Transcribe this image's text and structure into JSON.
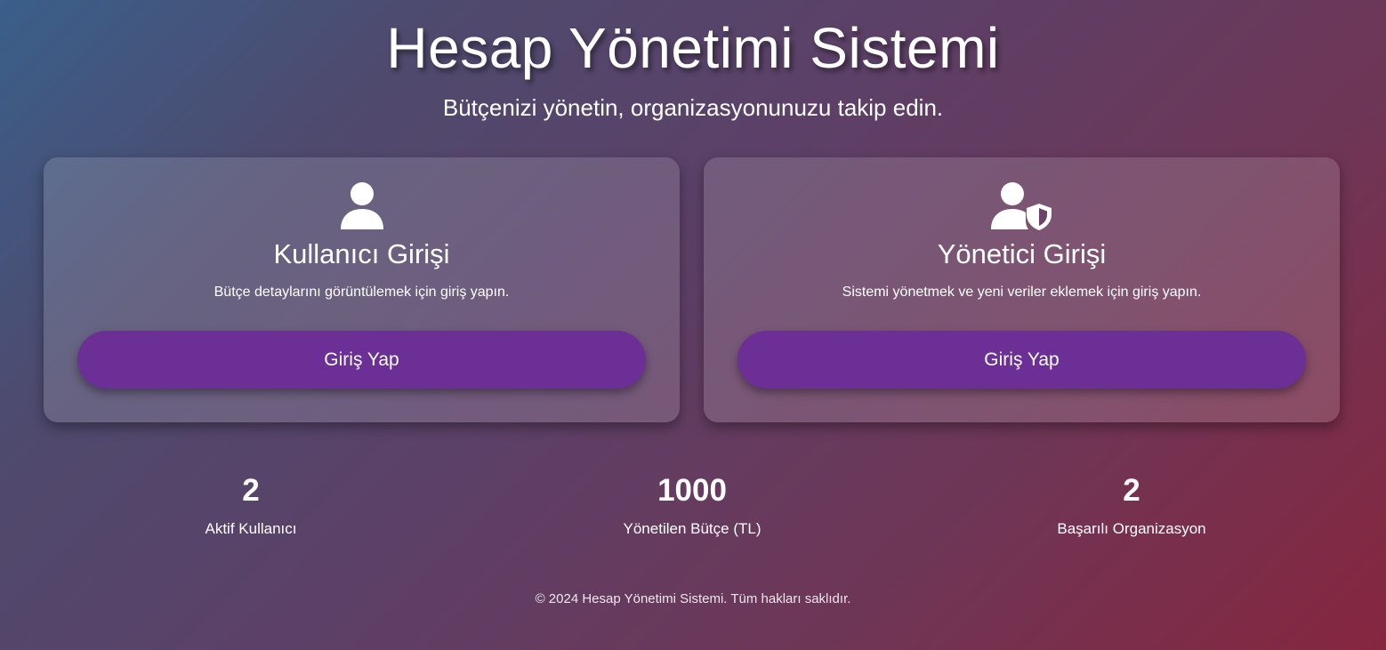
{
  "header": {
    "title": "Hesap Yönetimi Sistemi",
    "subtitle": "Bütçenizi yönetin, organizasyonunuzu takip edin."
  },
  "cards": [
    {
      "icon": "user-icon",
      "title": "Kullanıcı Girişi",
      "description": "Bütçe detaylarını görüntülemek için giriş yapın.",
      "button_label": "Giriş Yap"
    },
    {
      "icon": "user-shield-icon",
      "title": "Yönetici Girişi",
      "description": "Sistemi yönetmek ve yeni veriler eklemek için giriş yapın.",
      "button_label": "Giriş Yap"
    }
  ],
  "stats": [
    {
      "value": "2",
      "label": "Aktif Kullanıcı"
    },
    {
      "value": "1000",
      "label": "Yönetilen Bütçe (TL)"
    },
    {
      "value": "2",
      "label": "Başarılı Organizasyon"
    }
  ],
  "footer": {
    "text": "© 2024 Hesap Yönetimi Sistemi. Tüm hakları saklıdır."
  },
  "colors": {
    "button": "#6b2f96",
    "background_start": "#3a5f8a",
    "background_end": "#86263f"
  }
}
